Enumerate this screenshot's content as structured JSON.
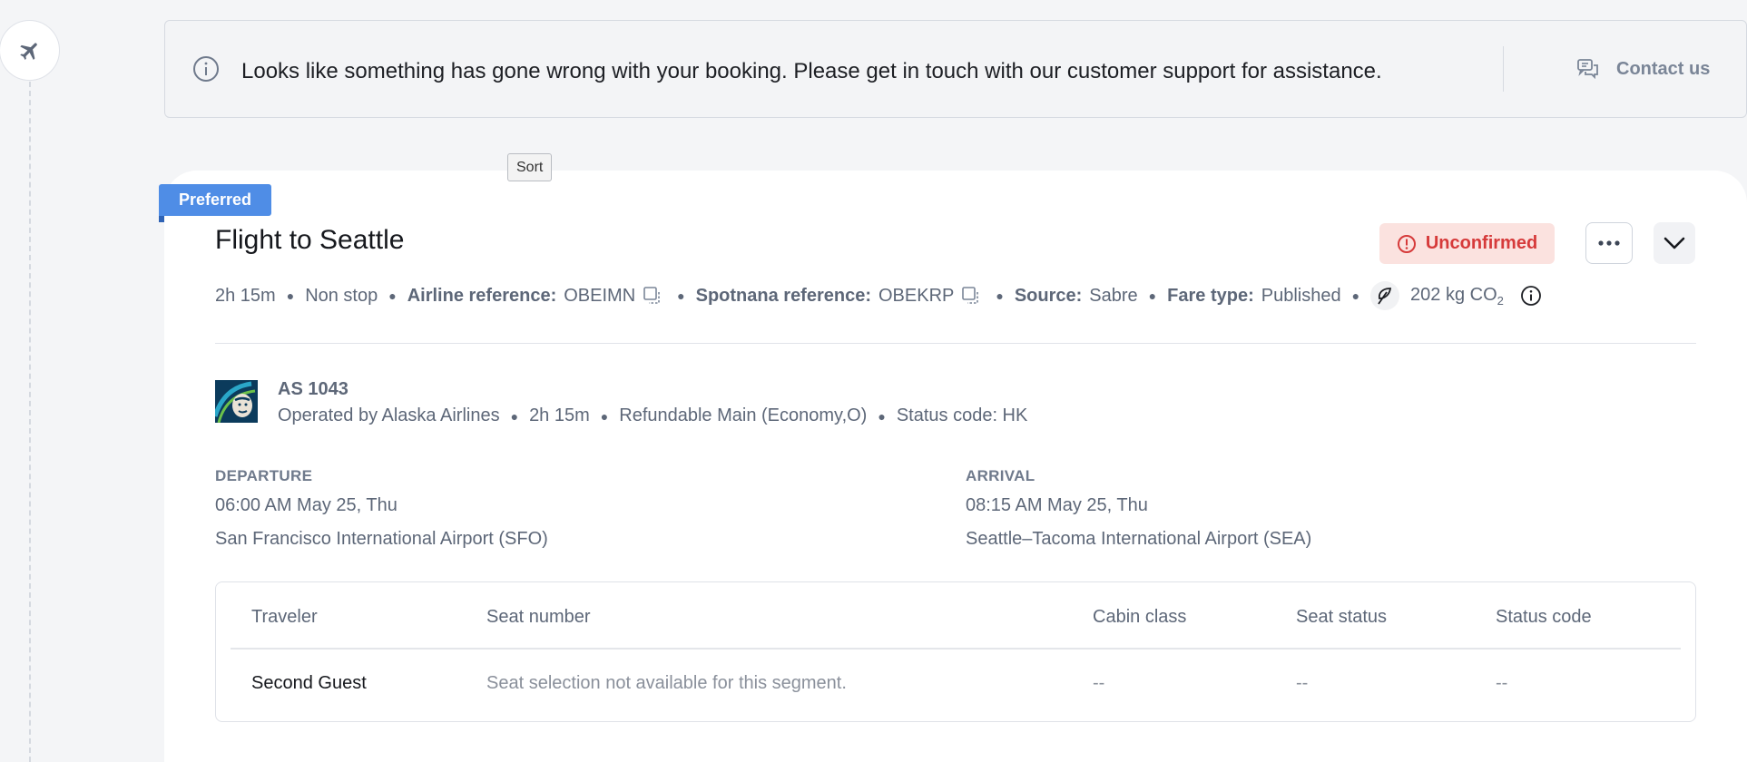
{
  "alert": {
    "message": "Looks like something has gone wrong with your booking. Please get in touch with our customer support for assistance.",
    "contact_label": "Contact us"
  },
  "tooltip": "Sort",
  "badge": "Preferred",
  "flight": {
    "title": "Flight to Seattle",
    "status": "Unconfirmed",
    "status_color": "#d63a3a",
    "duration": "2h 15m",
    "stops": "Non stop",
    "airline_ref_label": "Airline reference:",
    "airline_ref": "OBEIMN",
    "spotnana_ref_label": "Spotnana reference:",
    "spotnana_ref": "OBEKRP",
    "source_label": "Source:",
    "source": "Sabre",
    "fare_type_label": "Fare type:",
    "fare_type": "Published",
    "emissions": "202 kg CO",
    "emissions_sub": "2"
  },
  "segment": {
    "flight_number": "AS 1043",
    "operated_by": "Operated by Alaska Airlines",
    "duration": "2h 15m",
    "fare_class": "Refundable Main (Economy,O)",
    "status_code": "Status code: HK",
    "departure": {
      "label": "DEPARTURE",
      "time": "06:00 AM May 25, Thu",
      "airport": "San Francisco International Airport (SFO)"
    },
    "arrival": {
      "label": "ARRIVAL",
      "time": "08:15 AM May 25, Thu",
      "airport": "Seattle–Tacoma International Airport (SEA)"
    }
  },
  "table": {
    "headers": [
      "Traveler",
      "Seat number",
      "Cabin class",
      "Seat status",
      "Status code"
    ],
    "rows": [
      [
        "Second Guest",
        "Seat selection not available for this segment.",
        "--",
        "--",
        "--"
      ]
    ]
  },
  "colors": {
    "accent": "#4f8de6",
    "danger": "#d63a3a",
    "danger_bg": "#fbe2df",
    "muted_text": "#5d6778"
  }
}
